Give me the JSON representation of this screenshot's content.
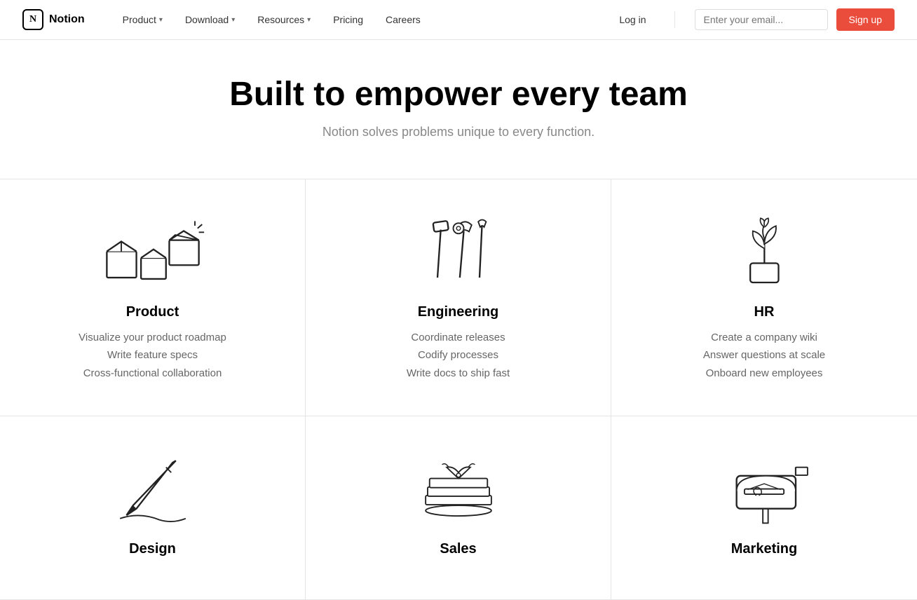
{
  "nav": {
    "logo_text": "Notion",
    "items": [
      {
        "label": "Product",
        "has_dropdown": true
      },
      {
        "label": "Download",
        "has_dropdown": true
      },
      {
        "label": "Resources",
        "has_dropdown": true
      },
      {
        "label": "Pricing",
        "has_dropdown": false
      },
      {
        "label": "Careers",
        "has_dropdown": false
      }
    ],
    "login_label": "Log in",
    "email_placeholder": "Enter your email...",
    "signup_label": "Sign up"
  },
  "hero": {
    "title": "Built to empower every team",
    "subtitle": "Notion solves problems unique to every function."
  },
  "teams": [
    {
      "name": "Product",
      "desc_lines": [
        "Visualize your product roadmap",
        "Write feature specs",
        "Cross-functional collaboration"
      ],
      "icon_type": "boxes"
    },
    {
      "name": "Engineering",
      "desc_lines": [
        "Coordinate releases",
        "Codify processes",
        "Write docs to ship fast"
      ],
      "icon_type": "tools"
    },
    {
      "name": "HR",
      "desc_lines": [
        "Create a company wiki",
        "Answer questions at scale",
        "Onboard new employees"
      ],
      "icon_type": "plant"
    },
    {
      "name": "Design",
      "desc_lines": [],
      "icon_type": "pen"
    },
    {
      "name": "Sales",
      "desc_lines": [],
      "icon_type": "books"
    },
    {
      "name": "Marketing",
      "desc_lines": [],
      "icon_type": "mailbox"
    }
  ]
}
